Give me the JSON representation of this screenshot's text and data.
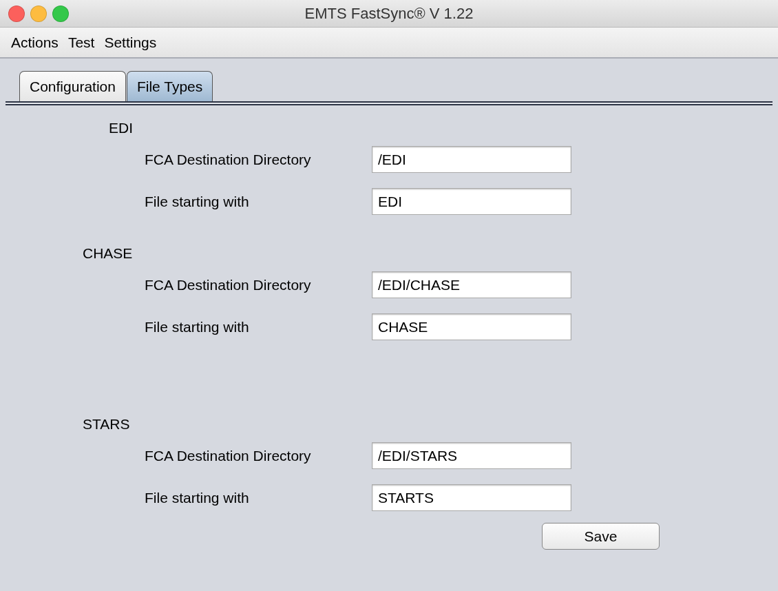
{
  "window": {
    "title": "EMTS FastSync® V 1.22"
  },
  "menu": [
    "Actions",
    "Test",
    "Settings"
  ],
  "tabs": [
    {
      "label": "Configuration",
      "selected": false
    },
    {
      "label": "File Types",
      "selected": true
    }
  ],
  "sections": [
    {
      "title": "EDI",
      "fields": [
        {
          "label": "FCA Destination Directory",
          "value": "/EDI"
        },
        {
          "label": "File starting with",
          "value": "EDI"
        }
      ]
    },
    {
      "title": "CHASE",
      "fields": [
        {
          "label": "FCA Destination Directory",
          "value": "/EDI/CHASE"
        },
        {
          "label": "File starting with",
          "value": "CHASE"
        }
      ]
    },
    {
      "title": "STARS",
      "fields": [
        {
          "label": "FCA Destination Directory",
          "value": "/EDI/STARS"
        },
        {
          "label": "File starting with",
          "value": "STARTS"
        }
      ]
    }
  ],
  "buttons": [
    "Save"
  ]
}
